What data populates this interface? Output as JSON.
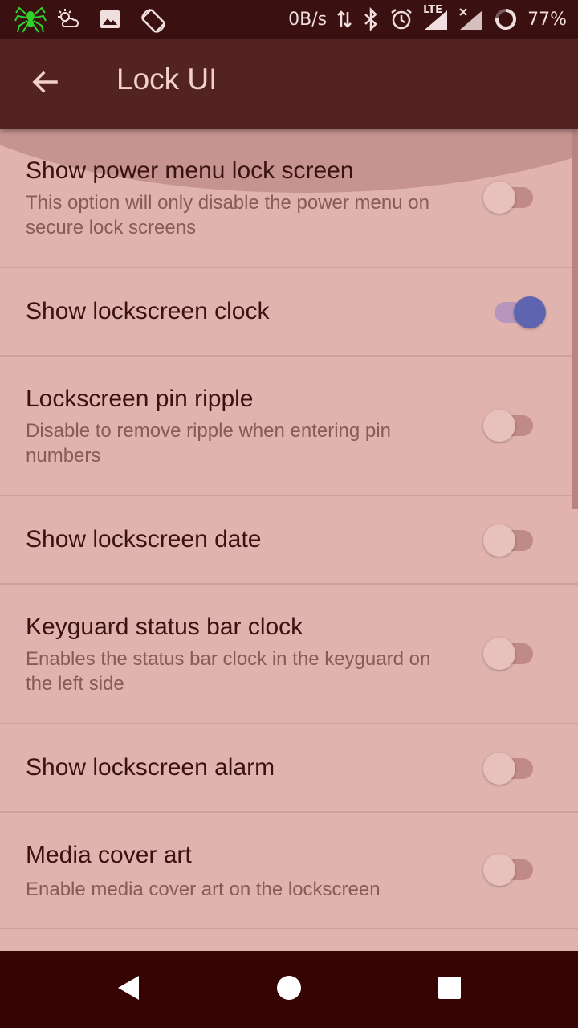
{
  "status_bar": {
    "speed": "0B/s",
    "battery_percent": "77%",
    "network": "LTE",
    "icons": [
      "spider-app-icon",
      "weather-icon",
      "image-icon",
      "rotate-icon",
      "data-arrows-icon",
      "bluetooth-icon",
      "alarm-icon",
      "signal-lte-icon",
      "signal-no-service-icon",
      "battery-ring-icon"
    ]
  },
  "app_bar": {
    "title": "Lock UI",
    "back_icon": "back-arrow-icon"
  },
  "settings": [
    {
      "title": "Show power menu lock screen",
      "summary": "This option will only disable the power menu on secure lock screens",
      "enabled": false
    },
    {
      "title": "Show lockscreen clock",
      "summary": "",
      "enabled": true
    },
    {
      "title": "Lockscreen pin ripple",
      "summary": "Disable to remove ripple when entering pin numbers",
      "enabled": false
    },
    {
      "title": "Show lockscreen date",
      "summary": "",
      "enabled": false
    },
    {
      "title": "Keyguard status bar clock",
      "summary": "Enables the status bar clock in the keyguard on the left side",
      "enabled": false
    },
    {
      "title": "Show lockscreen alarm",
      "summary": "",
      "enabled": false
    },
    {
      "title": "Media cover art",
      "summary": "Enable media cover art on the lockscreen",
      "enabled": false
    }
  ],
  "nav_bar": {
    "icons": [
      "back-triangle-icon",
      "home-circle-icon",
      "recents-square-icon"
    ]
  },
  "colors": {
    "status_bar": "#3a1110",
    "app_bar": "#522321",
    "background": "#e0b3ae",
    "accent": "#5f64b0",
    "nav_bar": "#360403"
  }
}
